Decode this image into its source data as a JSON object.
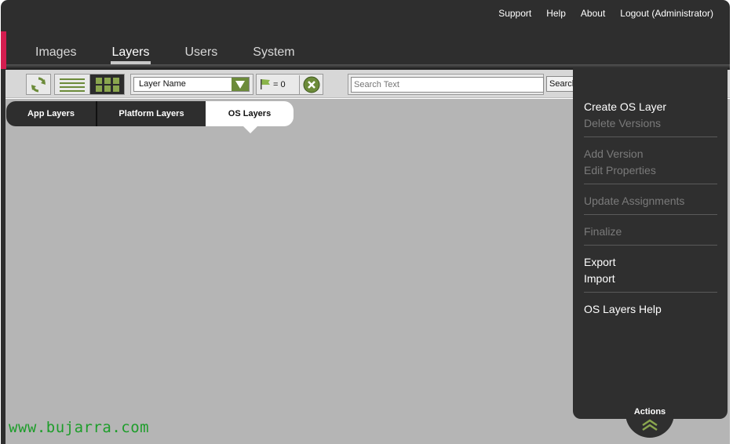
{
  "top_links": [
    "Support",
    "Help",
    "About",
    "Logout (Administrator)"
  ],
  "main_tabs": [
    {
      "label": "Images",
      "active": false
    },
    {
      "label": "Layers",
      "active": true
    },
    {
      "label": "Users",
      "active": false
    },
    {
      "label": "System",
      "active": false
    }
  ],
  "toolbar": {
    "sort_value": "Layer Name",
    "flag_count": "= 0",
    "search_placeholder": "Search Text",
    "search_button": "Search"
  },
  "sub_tabs": [
    {
      "label": "App Layers",
      "active": false
    },
    {
      "label": "Platform Layers",
      "active": false
    },
    {
      "label": "OS Layers",
      "active": true
    }
  ],
  "actions": {
    "label": "Actions",
    "groups": [
      [
        {
          "label": "Create OS Layer",
          "enabled": true
        },
        {
          "label": "Delete Versions",
          "enabled": false
        }
      ],
      [
        {
          "label": "Add Version",
          "enabled": false
        },
        {
          "label": "Edit Properties",
          "enabled": false
        }
      ],
      [
        {
          "label": "Update Assignments",
          "enabled": false
        }
      ],
      [
        {
          "label": "Finalize",
          "enabled": false
        }
      ],
      [
        {
          "label": "Export",
          "enabled": true
        },
        {
          "label": "Import",
          "enabled": true
        }
      ],
      [
        {
          "label": "OS Layers Help",
          "enabled": true
        }
      ]
    ]
  },
  "watermark": "www.bujarra.com",
  "colors": {
    "accent_green": "#6c8b3a",
    "brand_red": "#d31d4f",
    "watermark_green": "#1d9d2a"
  }
}
